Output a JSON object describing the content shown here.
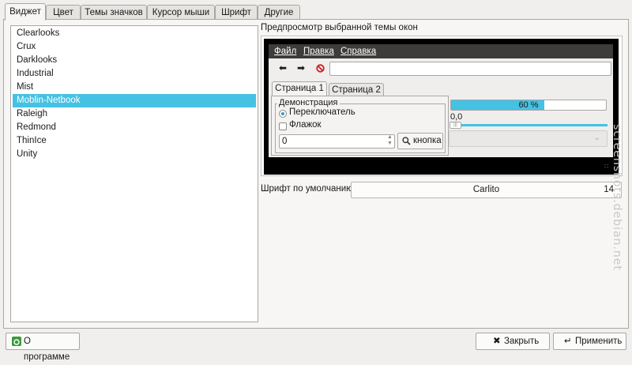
{
  "tabs": [
    "Виджет",
    "Цвет",
    "Темы значков",
    "Курсор мыши",
    "Шрифт",
    "Другие"
  ],
  "active_tab": "Виджет",
  "themes": [
    "Clearlooks",
    "Crux",
    "Darklooks",
    "Industrial",
    "Mist",
    "Moblin-Netbook",
    "Raleigh",
    "Redmond",
    "ThinIce",
    "Unity"
  ],
  "selected_theme": "Moblin-Netbook",
  "preview": {
    "label": "Предпросмотр выбранной темы окон",
    "menu": [
      "Файл",
      "Правка",
      "Справка"
    ],
    "toolbar_icons": [
      "arrow-left-icon",
      "arrow-right-icon",
      "stop-icon"
    ],
    "tabs": [
      "Страница 1",
      "Страница 2"
    ],
    "fieldset_legend": "Демонстрация",
    "radio_label": "Переключатель",
    "check_label": "Флажок",
    "spin_value": "0",
    "button_label": "кнопка",
    "progress_text": "60 %",
    "progress_value": 0.6,
    "slider_value_text": "0,0",
    "slider_value": 0.0
  },
  "font": {
    "label": "Шрифт по умолчанию:",
    "name": "Carlito",
    "size": "14"
  },
  "buttons": {
    "about": "О программе",
    "close": "Закрыть",
    "apply": "Применить"
  },
  "watermark": "screenshots.debian.net",
  "colors": {
    "accent": "#45c1e3",
    "menubar": "#3d3c3b"
  }
}
